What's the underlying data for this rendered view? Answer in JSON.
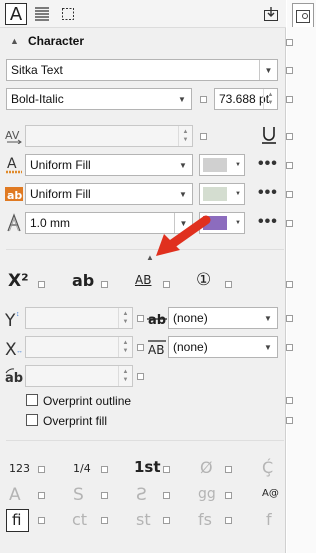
{
  "toolbar": {
    "tabs": [
      {
        "icon": "character-icon",
        "glyph": "A"
      },
      {
        "icon": "paragraph-icon",
        "glyph": "≡"
      },
      {
        "icon": "frame-icon",
        "glyph": "⬚"
      }
    ]
  },
  "section": {
    "title": "Character"
  },
  "font": {
    "family": "Sitka Text",
    "style": "Bold-Italic",
    "size": "73.688 pt"
  },
  "fills": {
    "text_fill": "Uniform Fill",
    "background_fill": "Uniform Fill",
    "outline_width": "1.0 mm",
    "text_fill_color": "#d0d0d0",
    "background_fill_color": "#d4ddd0",
    "outline_color": "#8c6cbe"
  },
  "more_label": "•••",
  "opentype": {
    "superscript": "X²",
    "underline_ab": "ab",
    "allcaps_ab": "AB",
    "numeral_one": "①"
  },
  "position": {
    "strike_value": "(none)",
    "overline_value": "(none)"
  },
  "options": {
    "overprint_outline": "Overprint outline",
    "overprint_fill": "Overprint fill"
  },
  "features": {
    "row1": [
      "123",
      "1/4",
      "1st",
      "Ø",
      "Ḉ"
    ],
    "row2": [
      "A",
      "S",
      "Ƨ",
      "gg",
      "A@"
    ],
    "row3": [
      "fi",
      "ct",
      "st",
      "fs",
      "f"
    ]
  },
  "colors": {
    "accent_arrow": "#e0301e",
    "panel_bg": "#f0f0f0"
  }
}
